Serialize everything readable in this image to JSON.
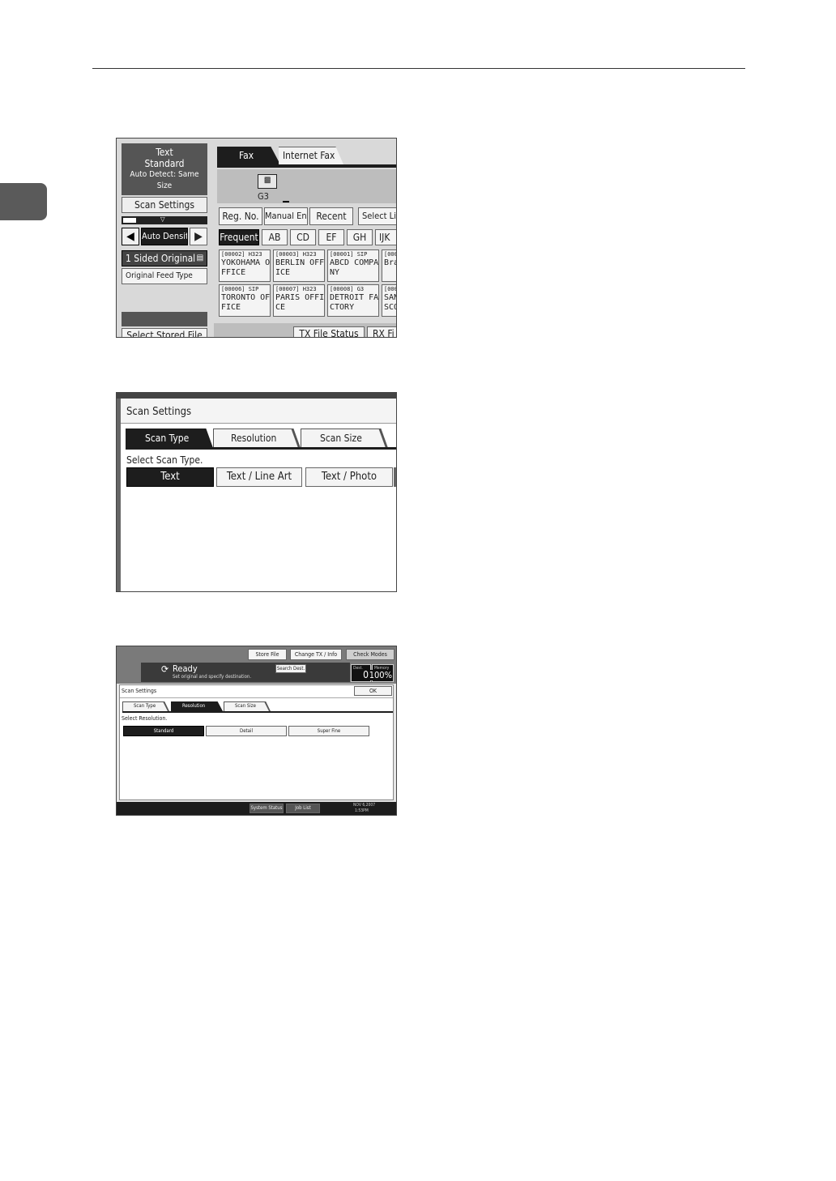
{
  "shot1": {
    "summary": {
      "line1": "Text",
      "line2": "Standard",
      "line3": "Auto Detect: Same Size"
    },
    "scan_settings": "Scan Settings",
    "auto_density": "Auto Density",
    "sided_original": "1 Sided Original",
    "original_feed_type": "Original Feed Type",
    "select_stored_file": "Select Stored File",
    "tab_fax": "Fax",
    "tab_internet_fax": "Internet Fax",
    "g3_label": "G3",
    "buttons": {
      "reg_no": "Reg. No.",
      "manual_entry": "Manual Entry",
      "recent": "Recent",
      "select_line": "Select Line"
    },
    "index_tabs": [
      "Frequent",
      "AB",
      "CD",
      "EF",
      "GH",
      "IJK"
    ],
    "destinations": [
      {
        "code": "[00002] H323",
        "name": "YOKOHAMA O",
        "name2": "FFICE"
      },
      {
        "code": "[00003] H323",
        "name": "BERLIN OFF",
        "name2": "ICE"
      },
      {
        "code": "[00001] SIP",
        "name": "ABCD COMPA",
        "name2": "NY"
      },
      {
        "code": "[000",
        "name": "Bra",
        "name2": ""
      },
      {
        "code": "[00006] SIP",
        "name": "TORONTO OF",
        "name2": "FICE"
      },
      {
        "code": "[00007] H323",
        "name": "PARIS OFFI",
        "name2": "CE"
      },
      {
        "code": "[00008] G3",
        "name": "DETROIT FA",
        "name2": "CTORY"
      },
      {
        "code": "[000",
        "name": "SAN",
        "name2": "SCO"
      }
    ],
    "tx_file_status": "TX File Status",
    "rx_file": "RX Fi"
  },
  "shot2": {
    "title": "Scan Settings",
    "tabs": [
      "Scan Type",
      "Resolution",
      "Scan Size"
    ],
    "prompt": "Select Scan Type.",
    "options": [
      "Text",
      "Text / Line Art",
      "Text / Photo"
    ],
    "selected": "Text"
  },
  "shot3": {
    "top_buttons": [
      "Store File",
      "Change TX / Info",
      "Check Modes"
    ],
    "status": "Ready",
    "status_sub": "Set original and specify destination.",
    "search_dest": "Search Dest.",
    "dest_label": "Dest.",
    "dest_count": "0",
    "memory_label": "Memory",
    "memory_value": "100%",
    "title": "Scan Settings",
    "ok": "OK",
    "tabs": [
      "Scan Type",
      "Resolution",
      "Scan Size"
    ],
    "prompt": "Select Resolution.",
    "options": [
      "Standard",
      "Detail",
      "Super Fine"
    ],
    "selected": "Standard",
    "bottom_buttons": [
      "System Status",
      "Job List"
    ],
    "date": "NOV 6,2007",
    "time": "1:53PM"
  }
}
